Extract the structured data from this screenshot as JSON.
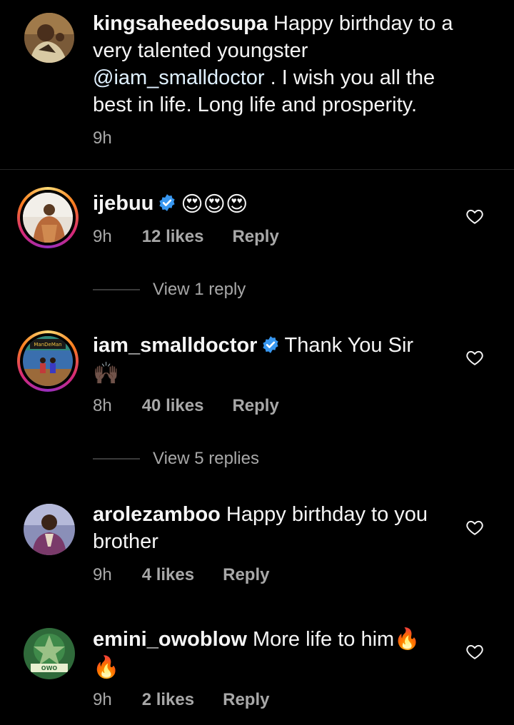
{
  "caption": {
    "username": "kingsaheedosupa",
    "text_before_mention": " Happy birthday to a very talented youngster ",
    "mention": "@iam_smalldoctor",
    "text_after_mention": " . I wish you all the best in life. Long life and prosperity.",
    "time": "9h"
  },
  "comments": [
    {
      "username": "ijebuu",
      "verified": true,
      "text": "😍😍😍",
      "time": "9h",
      "likes": "12 likes",
      "reply": "Reply",
      "view_replies": "View 1 reply",
      "avatar_ring": true
    },
    {
      "username": "iam_smalldoctor",
      "verified": true,
      "text": "Thank You Sir",
      "text_line2": "🙌🏿",
      "time": "8h",
      "likes": "40 likes",
      "reply": "Reply",
      "view_replies": "View 5 replies",
      "avatar_ring": true
    },
    {
      "username": "arolezamboo",
      "verified": false,
      "text": " Happy birthday to you brother",
      "time": "9h",
      "likes": "4 likes",
      "reply": "Reply",
      "avatar_ring": false
    },
    {
      "username": "emini_owoblow",
      "verified": false,
      "text": " More life to him🔥",
      "text_line2": "🔥",
      "time": "9h",
      "likes": "2 likes",
      "reply": "Reply",
      "avatar_ring": false
    }
  ],
  "icons": {
    "like": "heart-outline-icon",
    "verified": "verified-badge-icon"
  },
  "colors": {
    "background": "#000000",
    "text": "#f5f5f5",
    "secondary": "#a8a8a8",
    "verified": "#3897f0"
  }
}
